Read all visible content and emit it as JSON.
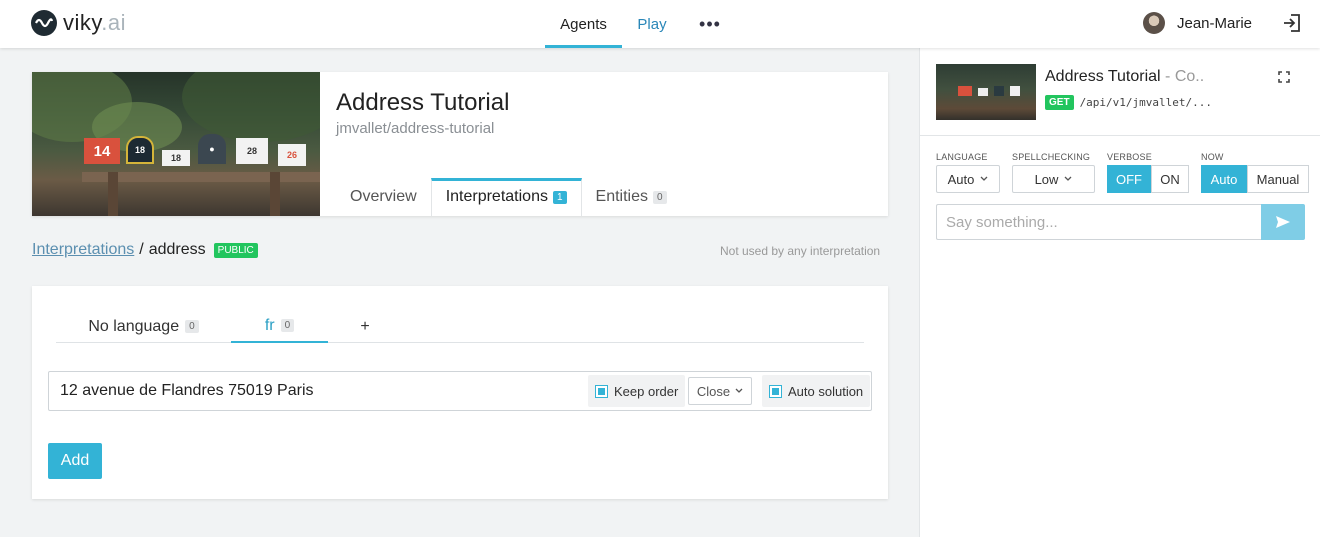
{
  "header": {
    "logo": {
      "name": "viky",
      "suffix": ".ai"
    },
    "nav": [
      {
        "label": "Agents",
        "active": true
      },
      {
        "label": "Play",
        "active": false
      }
    ],
    "more_icon": "ellipsis-icon",
    "user": {
      "name": "Jean-Marie"
    },
    "logout_icon": "logout-icon"
  },
  "agent": {
    "name": "Address Tutorial",
    "slug": "jmvallet/address-tutorial",
    "tabs": [
      {
        "label": "Overview",
        "count": null,
        "active": false
      },
      {
        "label": "Interpretations",
        "count": "1",
        "active": true
      },
      {
        "label": "Entities",
        "count": "0",
        "active": false
      }
    ]
  },
  "breadcrumb": {
    "parent": "Interpretations",
    "separator": "/",
    "current": "address",
    "badge": "PUBLIC"
  },
  "usage_note": "Not used by any interpretation",
  "languages": [
    {
      "label": "No language",
      "count": "0",
      "active": false
    },
    {
      "label": "fr",
      "count": "0",
      "active": true
    },
    {
      "label": "+",
      "count": null,
      "active": false
    }
  ],
  "formulation": {
    "text": "12 avenue de Flandres 75019 Paris",
    "keep_order": {
      "label": "Keep order",
      "checked": true
    },
    "proximity": "Close",
    "auto_solution": {
      "label": "Auto solution",
      "checked": true
    }
  },
  "add_button": "Add",
  "console": {
    "title": "Address Tutorial",
    "title_suffix": " - Co...",
    "method": "GET",
    "endpoint": "/api/v1/jmvallet/...",
    "language": {
      "label": "LANGUAGE",
      "value": "Auto"
    },
    "spellchecking": {
      "label": "SPELLCHECKING",
      "value": "Low"
    },
    "verbose": {
      "label": "VERBOSE",
      "options": [
        "OFF",
        "ON"
      ],
      "selected": "OFF"
    },
    "now": {
      "label": "NOW",
      "options": [
        "Auto",
        "Manual"
      ],
      "selected": "Auto"
    },
    "input_placeholder": "Say something...",
    "send_icon": "send-icon"
  },
  "colors": {
    "accent": "#33b3d6",
    "badge_green": "#22c55e",
    "link": "#5b8fb0"
  }
}
